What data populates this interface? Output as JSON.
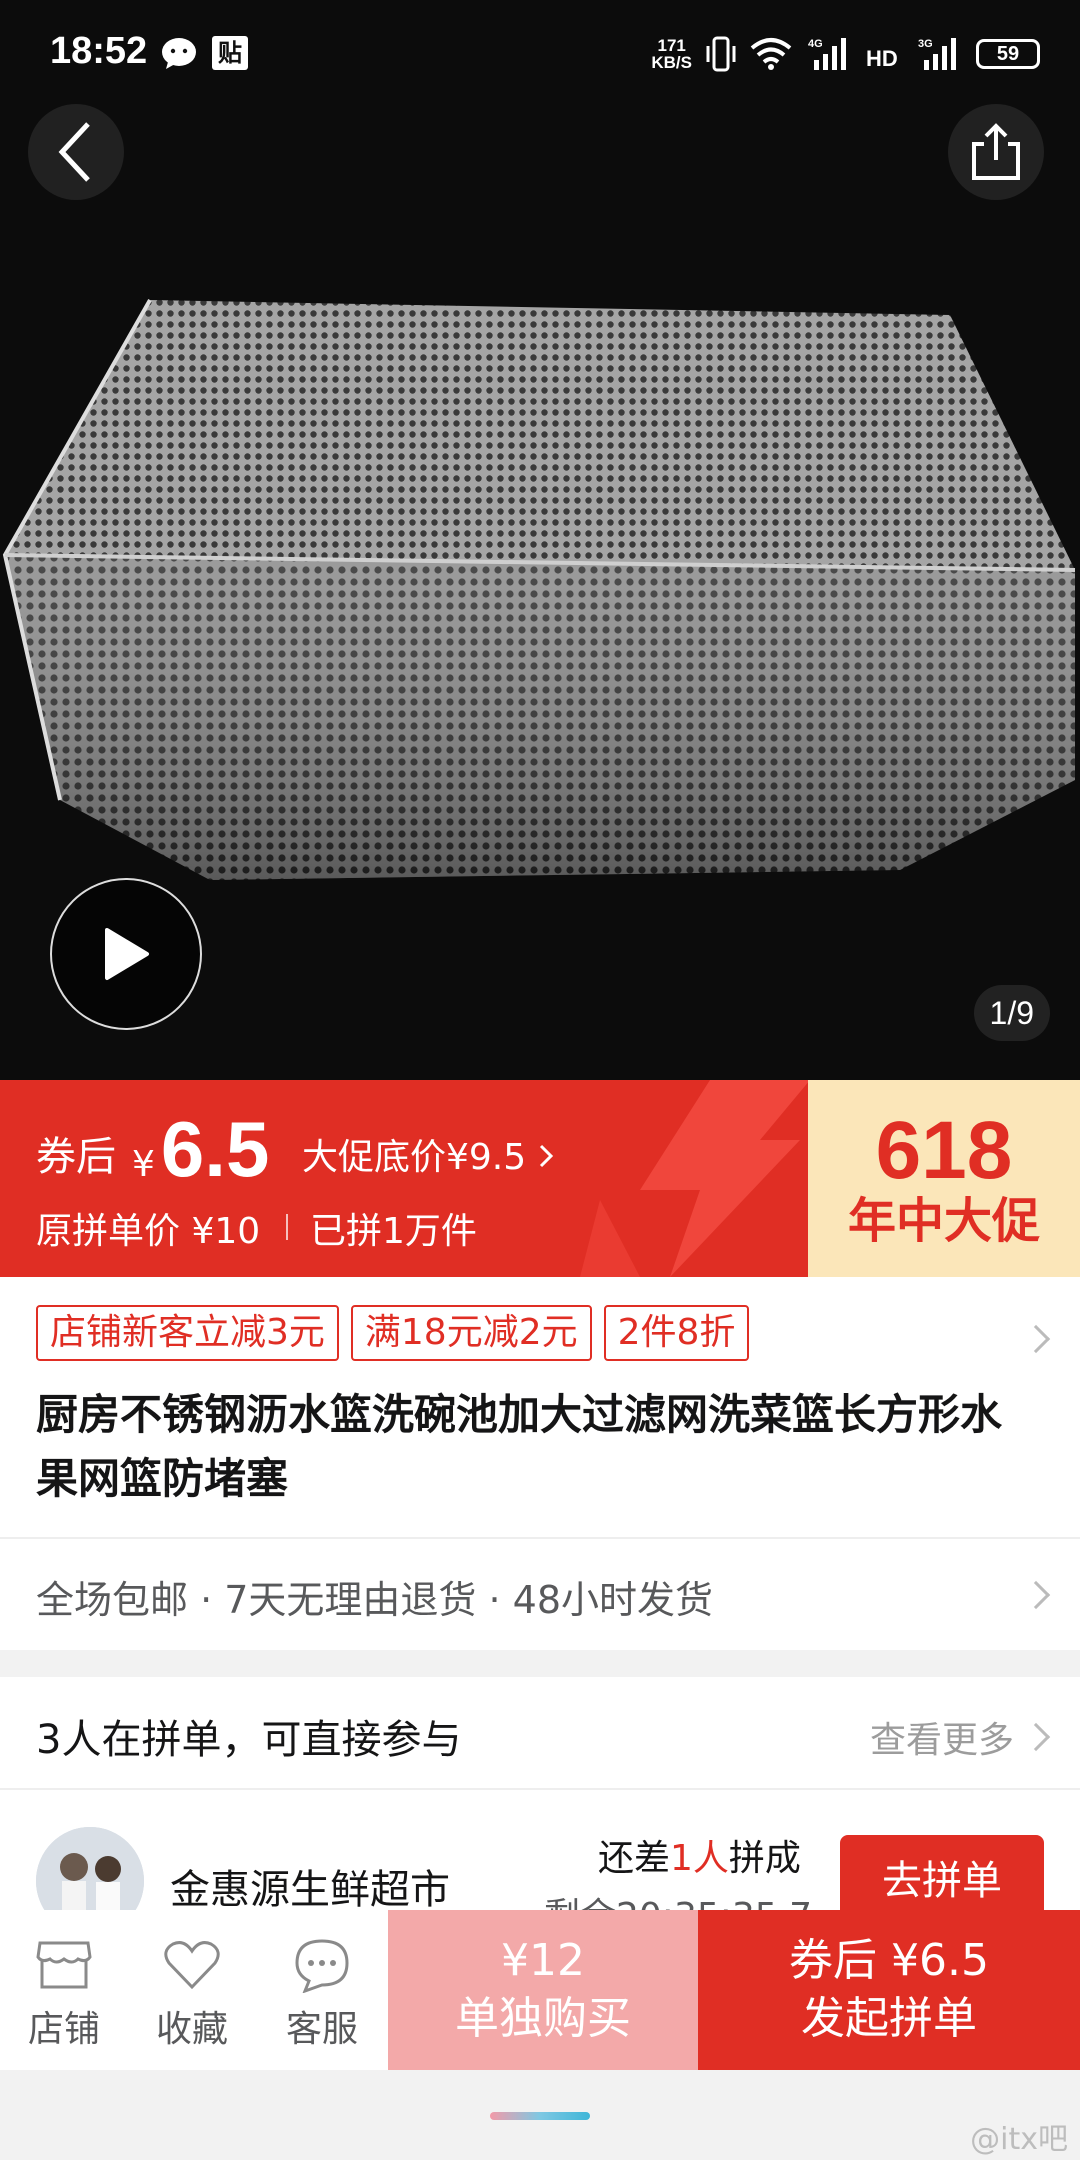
{
  "status_bar": {
    "time": "18:52",
    "app_badge": "贴",
    "net_speed_top": "171",
    "net_speed_bottom": "KB/S",
    "net1": "4G",
    "net2": "HD",
    "net3": "3G",
    "battery": "59"
  },
  "gallery": {
    "page_indicator": "1/9"
  },
  "price": {
    "coupon_label": "券后",
    "currency": "¥",
    "coupon_value": "6.5",
    "promo_floor": "大促底价¥9.5",
    "original": "原拼单价 ¥10",
    "sold": "已拼1万件",
    "promo_big": "618",
    "promo_small": "年中大促"
  },
  "product": {
    "tags": [
      "店铺新客立减3元",
      "满18元减2元",
      "2件8折"
    ],
    "title": "厨房不锈钢沥水篮洗碗池加大过滤网洗菜篮长方形水果网篮防堵塞",
    "services": "全场包邮 · 7天无理由退货 · 48小时发货"
  },
  "group": {
    "heading": "3人在拼单，可直接参与",
    "see_more": "查看更多",
    "member_name": "金惠源生鲜超市",
    "need_prefix": "还差",
    "need_count": "1人",
    "need_suffix": "拼成",
    "remaining": "剩余20:35:35.7",
    "join_label": "去拼单"
  },
  "bottom_bar": {
    "shop": "店铺",
    "favorite": "收藏",
    "service": "客服",
    "single_price": "¥12",
    "single_label": "单独购买",
    "group_price": "券后 ¥6.5",
    "group_label": "发起拼单"
  },
  "watermark": "@itx吧",
  "colors": {
    "brand_red": "#e02e24",
    "promo_bg": "#fbe6b9",
    "single_buy_bg": "#f3a9a9"
  }
}
